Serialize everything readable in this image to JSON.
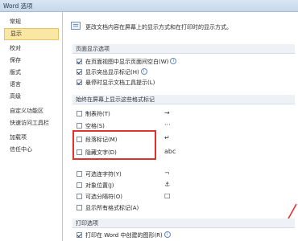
{
  "window": {
    "title": "Word 选项"
  },
  "sidebar": {
    "items": [
      {
        "label": "常规"
      },
      {
        "label": "显示"
      },
      {
        "label": "校对"
      },
      {
        "label": "保存"
      },
      {
        "label": "版式"
      },
      {
        "label": "语言"
      },
      {
        "label": "高级"
      },
      {
        "label": "自定义功能区"
      },
      {
        "label": "快速访问工具栏"
      },
      {
        "label": "加载项"
      },
      {
        "label": "信任中心"
      }
    ],
    "active_index": 1
  },
  "main": {
    "description": "更改文档内容在屏幕上的显示方式和在打印时的显示方式。",
    "page_display": {
      "title": "页面显示选项",
      "options": [
        {
          "label": "在页面视图中显示页面间空白(W)",
          "checked": true,
          "info": "i"
        },
        {
          "label": "显示突出显示标记(H)",
          "checked": true,
          "info": "i"
        },
        {
          "label": "悬停时显示文档工具提示(L)",
          "checked": true
        }
      ]
    },
    "format_marks": {
      "title": "始终在屏幕上显示这些格式标记",
      "options": [
        {
          "label": "制表符(T)",
          "symbol": "→",
          "checked": false
        },
        {
          "label": "空格(S)",
          "symbol": "···",
          "checked": false
        },
        {
          "label": "段落标记(M)",
          "symbol": "↵",
          "checked": false
        },
        {
          "label": "隐藏文字(D)",
          "symbol": "abc",
          "checked": false
        },
        {
          "label": "可选连字符(Y)",
          "symbol": "¬",
          "checked": false
        },
        {
          "label": "对象位置(J)",
          "symbol": "⚓",
          "checked": false
        },
        {
          "label": "可选分隔符(O)",
          "symbol": "□",
          "checked": false
        },
        {
          "label": "显示所有格式标记(A)",
          "checked": false
        }
      ]
    },
    "print": {
      "title": "打印选项",
      "options": [
        {
          "label": "打印在 Word 中创建的图形(R)",
          "checked": true,
          "info": "i"
        }
      ]
    }
  },
  "colors": {
    "highlight": "#e3322d",
    "active_nav": "#fbe7a4"
  }
}
